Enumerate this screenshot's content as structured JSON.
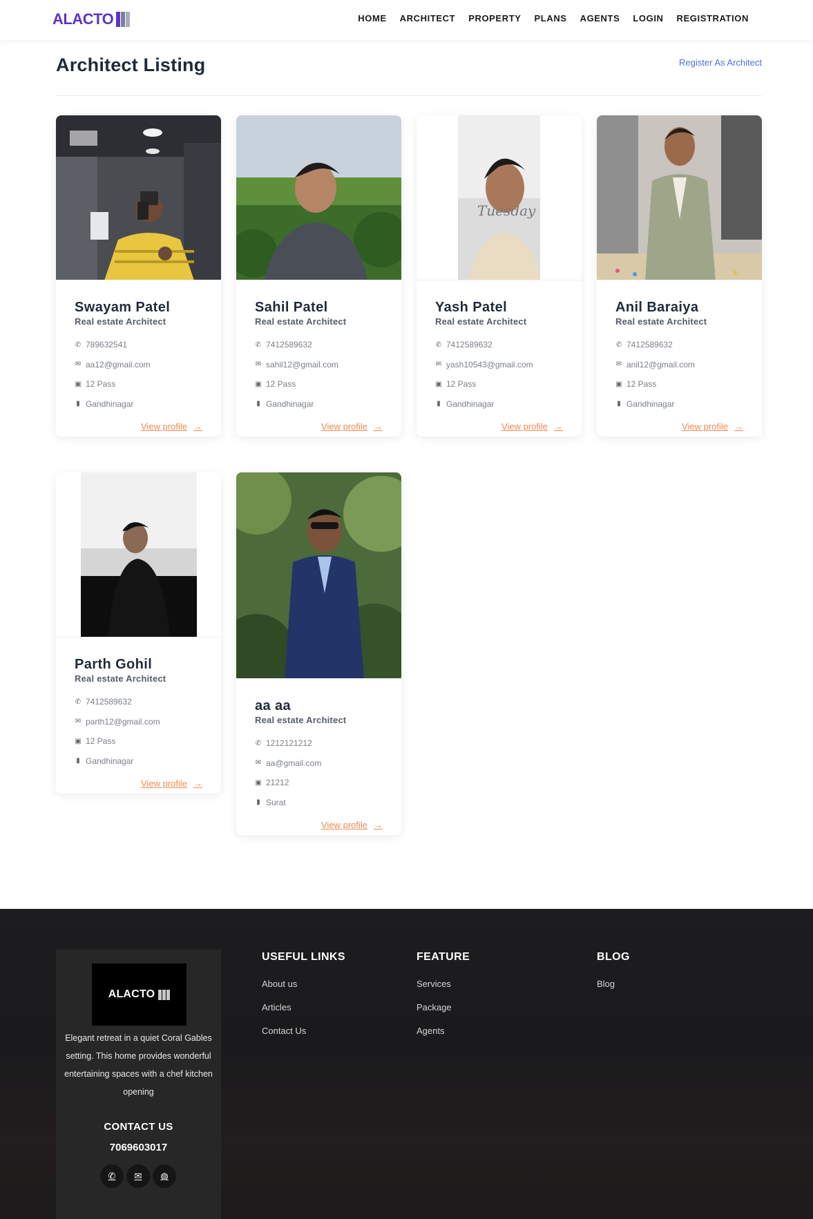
{
  "brand": {
    "logo_text": "ALACTO",
    "bar_colors": [
      "#5c34c8",
      "#7d7f9a",
      "#a9abc4"
    ]
  },
  "nav": {
    "items": [
      "HOME",
      "ARCHITECT",
      "PROPERTY",
      "PLANS",
      "AGENTS",
      "LOGIN",
      "REGISTRATION"
    ]
  },
  "page": {
    "title": "Architect Listing",
    "register_link": "Register As Architect"
  },
  "card_common": {
    "view_label": "View profile",
    "accent_color": "#f08a52"
  },
  "architects": [
    {
      "name": "Swayam Patel",
      "role": "Real estate Architect",
      "phone": "789632541",
      "email": "aa12@gmail.com",
      "qualification": "12 Pass",
      "city": "Gandhinagar"
    },
    {
      "name": "Sahil Patel",
      "role": "Real estate Architect",
      "phone": "7412589632",
      "email": "sahil12@gmail.com",
      "qualification": "12 Pass",
      "city": "Gandhinagar"
    },
    {
      "name": "Yash Patel",
      "role": "Real estate Architect",
      "phone": "7412589632",
      "email": "yash10543@gmail.com",
      "qualification": "12 Pass",
      "city": "Gandhinagar"
    },
    {
      "name": "Anil Baraiya",
      "role": "Real estate Architect",
      "phone": "7412589632",
      "email": "anil12@gmail.com",
      "qualification": "12 Pass",
      "city": "Gandhinagar"
    },
    {
      "name": "Parth Gohil",
      "role": "Real estate Architect",
      "phone": "7412589632",
      "email": "parth12@gmail.com",
      "qualification": "12 Pass",
      "city": "Gandhinagar"
    },
    {
      "name": "aa aa",
      "role": "Real estate Architect",
      "phone": "1212121212",
      "email": "aa@gmail.com",
      "qualification": "21212",
      "city": "Surat"
    }
  ],
  "footer": {
    "logo_text": "ALACTO",
    "description": "Elegant retreat in a quiet Coral Gables setting. This home provides wonderful entertaining spaces with a chef kitchen opening",
    "contact_title": "CONTACT US",
    "contact_phone": "7069603017",
    "social_icons": [
      "phone-icon",
      "envelope-icon",
      "globe-icon"
    ],
    "columns": [
      {
        "title": "USEFUL LINKS",
        "links": [
          "About us",
          "Articles",
          "Contact Us"
        ]
      },
      {
        "title": "FEATURE",
        "links": [
          "Services",
          "Package",
          "Agents"
        ]
      },
      {
        "title": "BLOG",
        "links": [
          "Blog"
        ]
      }
    ]
  }
}
